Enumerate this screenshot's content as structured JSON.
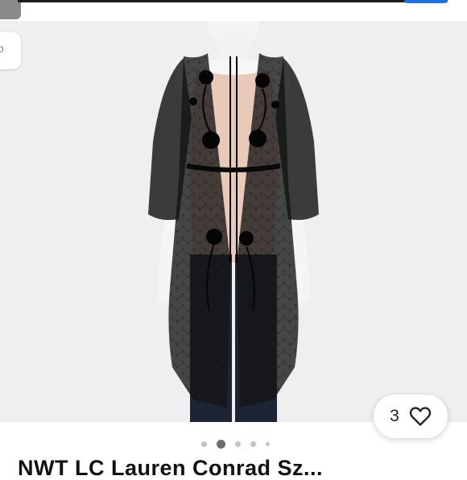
{
  "header": {
    "back_glyph": "p"
  },
  "listing": {
    "image_alt": "Black sheer lace embroidered duster kimono on mannequin",
    "like_count": "3",
    "carousel": {
      "total_images": 5,
      "active_index": 1
    },
    "title_partial": "NWT LC Lauren Conrad Sz..."
  },
  "colors": {
    "accent": "#1f6fe0",
    "garment": "#141414",
    "background": "#efefef"
  },
  "icons": {
    "like": "heart-outline-icon",
    "back": "chevron-back-icon"
  }
}
